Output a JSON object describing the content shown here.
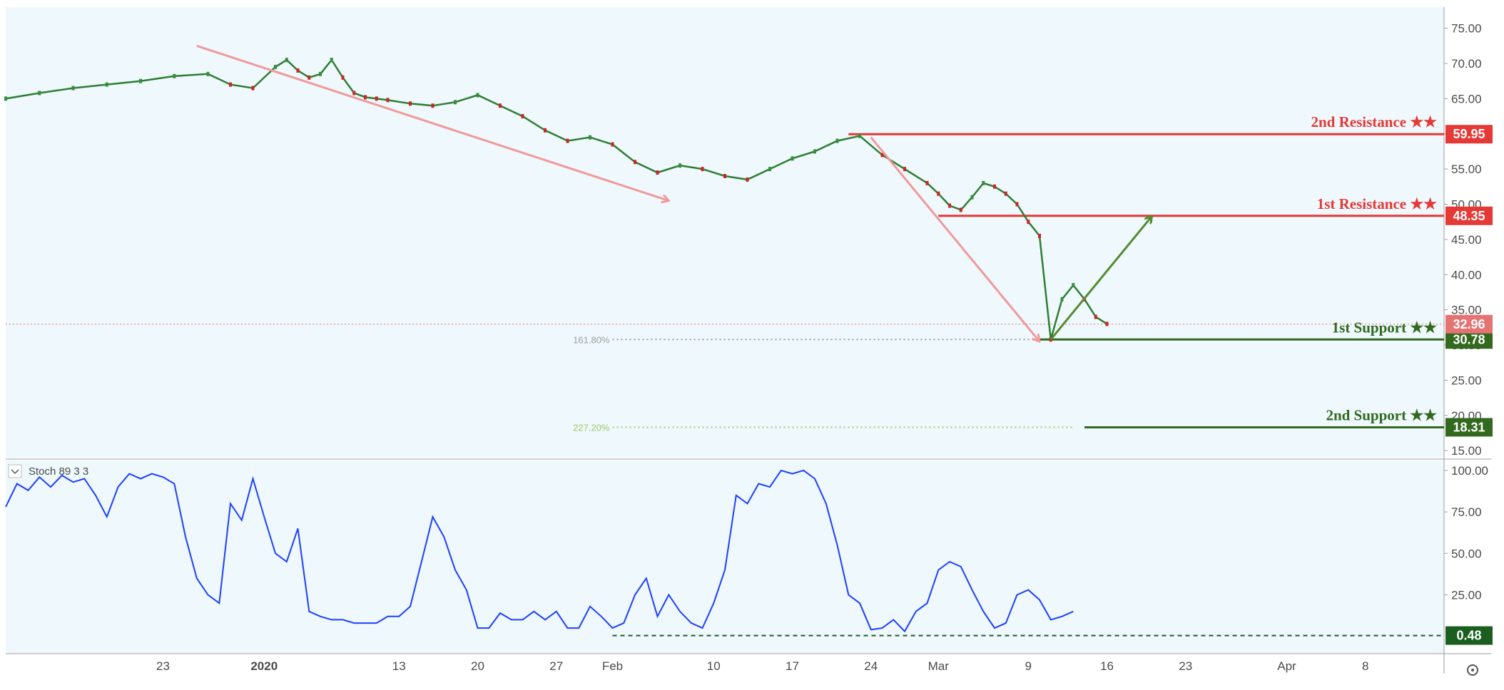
{
  "chart_data": [
    {
      "type": "line",
      "subtype": "candlestick-approx",
      "y_ticks": [
        "15.00",
        "20.00",
        "25.00",
        "30.00",
        "35.00",
        "40.00",
        "45.00",
        "50.00",
        "55.00",
        "60.00",
        "65.00",
        "70.00",
        "75.00"
      ],
      "ylim": [
        14,
        78
      ],
      "x_labels": [
        "23",
        "2020",
        "13",
        "20",
        "27",
        "Feb",
        "10",
        "17",
        "24",
        "Mar",
        "9",
        "16",
        "23",
        "Apr",
        "8"
      ],
      "x_label_days": [
        -9,
        0,
        12,
        19,
        26,
        31,
        40,
        47,
        54,
        60,
        68,
        75,
        82,
        91,
        98
      ],
      "x_range_days": [
        -23,
        105
      ],
      "series": [
        {
          "x_days": [
            -23,
            -20,
            -17,
            -14,
            -11,
            -8,
            -5,
            -3,
            -1,
            1,
            2,
            3,
            4,
            5,
            6,
            7,
            8,
            9,
            10,
            11,
            13,
            15,
            17,
            19,
            21,
            23,
            25,
            27,
            29,
            31,
            33,
            35,
            37,
            39,
            41,
            43,
            45,
            47,
            49,
            51,
            53,
            55,
            57,
            59,
            60,
            61,
            62,
            63,
            64,
            65,
            66,
            67,
            68,
            69,
            70,
            71,
            72,
            73,
            74,
            75
          ],
          "values": [
            65.0,
            65.8,
            66.5,
            67.0,
            67.5,
            68.2,
            68.5,
            67.0,
            66.5,
            69.5,
            70.5,
            69.0,
            68.0,
            68.5,
            70.5,
            68.0,
            65.8,
            65.2,
            65.0,
            64.8,
            64.3,
            64.0,
            64.5,
            65.5,
            64.0,
            62.5,
            60.5,
            59.0,
            59.5,
            58.5,
            56.0,
            54.5,
            55.5,
            55.0,
            54.0,
            53.5,
            55.0,
            56.5,
            57.5,
            59.0,
            59.7,
            57.0,
            55.0,
            53.0,
            51.5,
            49.8,
            49.2,
            51.0,
            53.0,
            52.5,
            51.5,
            50.0,
            47.5,
            45.5,
            30.78,
            36.5,
            38.5,
            36.5,
            34.0,
            33.0,
            34.5,
            32.96
          ]
        }
      ],
      "levels": [
        {
          "name": "2nd Resistance ★★",
          "value": 59.95,
          "label": "59.95",
          "color": "#e53935"
        },
        {
          "name": "1st Resistance ★★",
          "value": 48.35,
          "label": "48.35",
          "color": "#e53935"
        },
        {
          "name": "1st Support ★★",
          "value": 30.78,
          "label": "30.78",
          "color": "#33691e"
        },
        {
          "name": "2nd Support ★★",
          "value": 18.31,
          "label": "18.31",
          "color": "#33691e"
        }
      ],
      "current_price": {
        "value": 32.96,
        "label": "32.96",
        "color": "#e57373"
      },
      "fib_labels": [
        {
          "text": "161.80%",
          "value": 30.78,
          "color": "#a0a0a0"
        },
        {
          "text": "227.20%",
          "value": 18.31,
          "color": "#9ccc65"
        }
      ],
      "arrows": [
        {
          "from": [
            -6,
            72.5
          ],
          "to": [
            36,
            50.5
          ],
          "color": "#ef9a9a"
        },
        {
          "from": [
            54,
            59.5
          ],
          "to": [
            69,
            30.5
          ],
          "color": "#ef9a9a"
        },
        {
          "from": [
            70,
            30.78
          ],
          "to": [
            79,
            48.3
          ],
          "color": "#558b2f"
        }
      ]
    },
    {
      "type": "line",
      "title": "Stoch 89 3 3",
      "y_ticks": [
        "25.00",
        "50.00",
        "75.00",
        "100.00"
      ],
      "ylim": [
        -10,
        106
      ],
      "x_days": [
        -23,
        -22,
        -21,
        -20,
        -19,
        -18,
        -17,
        -16,
        -15,
        -14,
        -13,
        -12,
        -11,
        -10,
        -9,
        -8,
        -7,
        -6,
        -5,
        -4,
        -3,
        -2,
        -1,
        0,
        1,
        2,
        3,
        4,
        5,
        6,
        7,
        8,
        9,
        10,
        11,
        12,
        13,
        14,
        15,
        16,
        17,
        18,
        19,
        20,
        21,
        22,
        23,
        24,
        25,
        26,
        27,
        28,
        29,
        30,
        31,
        32,
        33,
        34,
        35,
        36,
        37,
        38,
        39,
        40,
        41,
        42,
        43,
        44,
        45,
        46,
        47,
        48,
        49,
        50,
        51,
        52,
        53,
        54,
        55,
        56,
        57,
        58,
        59,
        60,
        61,
        62,
        63,
        64,
        65,
        66,
        67,
        68,
        69,
        70,
        71,
        72,
        73,
        74,
        75
      ],
      "values": [
        78,
        92,
        88,
        96,
        90,
        97,
        93,
        95,
        85,
        72,
        90,
        98,
        95,
        98,
        96,
        92,
        60,
        35,
        25,
        20,
        80,
        70,
        95,
        72,
        50,
        45,
        65,
        15,
        12,
        10,
        10,
        8,
        8,
        8,
        12,
        12,
        18,
        45,
        72,
        60,
        40,
        28,
        5,
        5,
        14,
        10,
        10,
        15,
        10,
        15,
        5,
        5,
        18,
        12,
        5,
        8,
        25,
        35,
        12,
        25,
        15,
        8,
        5,
        20,
        40,
        85,
        80,
        92,
        90,
        100,
        98,
        100,
        95,
        80,
        55,
        25,
        20,
        4,
        5,
        10,
        3,
        15,
        20,
        40,
        45,
        42,
        28,
        15,
        5,
        8,
        25,
        28,
        22,
        10,
        12,
        15
      ],
      "reference_line": {
        "value": 0.48,
        "label": "0.48",
        "color": "#1b5e20"
      },
      "line_color": "#1e40ff"
    }
  ]
}
